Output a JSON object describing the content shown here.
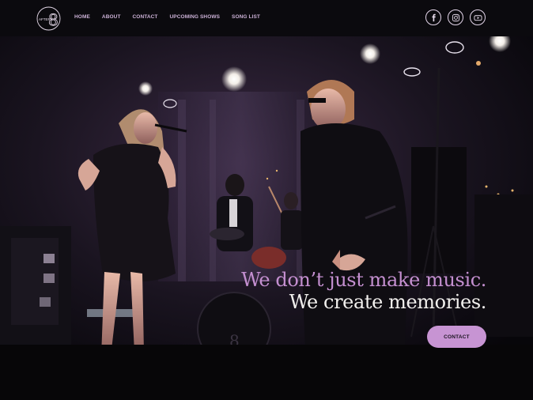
{
  "brand": {
    "logo_text": "AFTER",
    "logo_numeral": "8"
  },
  "nav": {
    "items": [
      {
        "label": "HOME"
      },
      {
        "label": "ABOUT"
      },
      {
        "label": "CONTACT"
      },
      {
        "label": "UPCOMING SHOWS"
      },
      {
        "label": "SONG LIST"
      }
    ]
  },
  "social": [
    "facebook-icon",
    "instagram-icon",
    "youtube-icon"
  ],
  "hero": {
    "headline_line1": "We don’t just make music.",
    "headline_line2": "We create memories.",
    "cta_label": "CONTACT"
  },
  "colors": {
    "accent": "#c794d3",
    "nav_text": "#cbb1d6",
    "background": "#0b0a0d",
    "headline_primary": "#c48fd0",
    "headline_secondary": "#f2f0ee"
  }
}
